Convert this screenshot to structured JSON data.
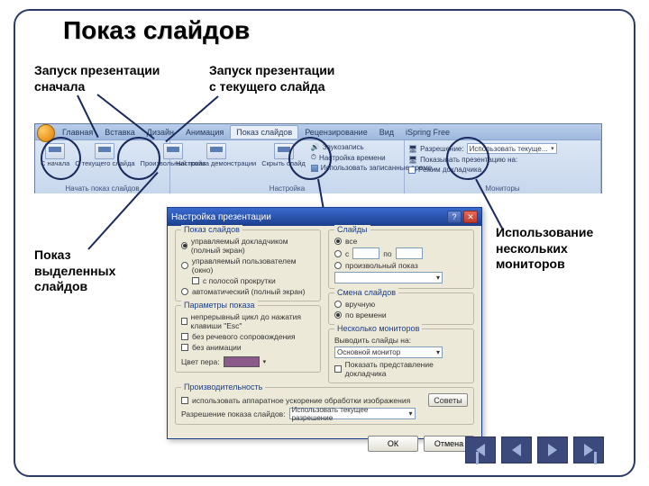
{
  "title": "Показ слайдов",
  "labels": {
    "from_begin": "Запуск презентации\nсначала",
    "from_current": "Запуск презентации\nс текущего слайда",
    "custom_show": "Показ\nвыделенных\nслайдов",
    "monitors": "Использование\nнескольких\nмониторов"
  },
  "ribbon": {
    "tabs": [
      "Главная",
      "Вставка",
      "Дизайн",
      "Анимация",
      "Показ слайдов",
      "Рецензирование",
      "Вид",
      "iSpring Free"
    ],
    "active_tab": "Показ слайдов",
    "group1": {
      "title": "Начать показ слайдов",
      "btns": [
        "С начала",
        "С текущего слайда",
        "Произвольный показ"
      ]
    },
    "group2": {
      "title": "Настройка",
      "btns": [
        "Настройка демонстрации",
        "Скрыть слайд"
      ],
      "lines": [
        "Звукозапись",
        "Настройка времени",
        "Использовать записанные време..."
      ]
    },
    "group3": {
      "title": "Мониторы",
      "res_label": "Разрешение:",
      "res_value": "Использовать текуще...",
      "show_on": "Показывать презентацию на:",
      "presenter": "Режим докладчика"
    }
  },
  "dialog": {
    "title": "Настройка презентации",
    "fs_show": "Показ слайдов",
    "show_opts": [
      "управляемый докладчиком (полный экран)",
      "управляемый пользователем (окно)",
      "с полосой прокрутки",
      "автоматический (полный экран)"
    ],
    "fs_slides": "Слайды",
    "slides_all": "все",
    "slides_from": "с",
    "slides_to": "по",
    "slides_custom": "произвольный показ",
    "fs_params": "Параметры показа",
    "params": [
      "непрерывный цикл до нажатия клавиши \"Esc\"",
      "без речевого сопровождения",
      "без анимации"
    ],
    "pen_color": "Цвет пера:",
    "fs_advance": "Смена слайдов",
    "adv_opts": [
      "вручную",
      "по времени"
    ],
    "fs_mon": "Несколько мониторов",
    "mon_label": "Выводить слайды на:",
    "mon_value": "Основной монитор",
    "mon_presenter": "Показать представление докладчика",
    "fs_perf": "Производительность",
    "perf_hw": "использовать аппаратное ускорение обработки изображения",
    "perf_tips": "Советы",
    "res_label": "Разрешение показа слайдов:",
    "res_value": "Использовать текущее разрешение",
    "ok": "ОК",
    "cancel": "Отмена"
  }
}
